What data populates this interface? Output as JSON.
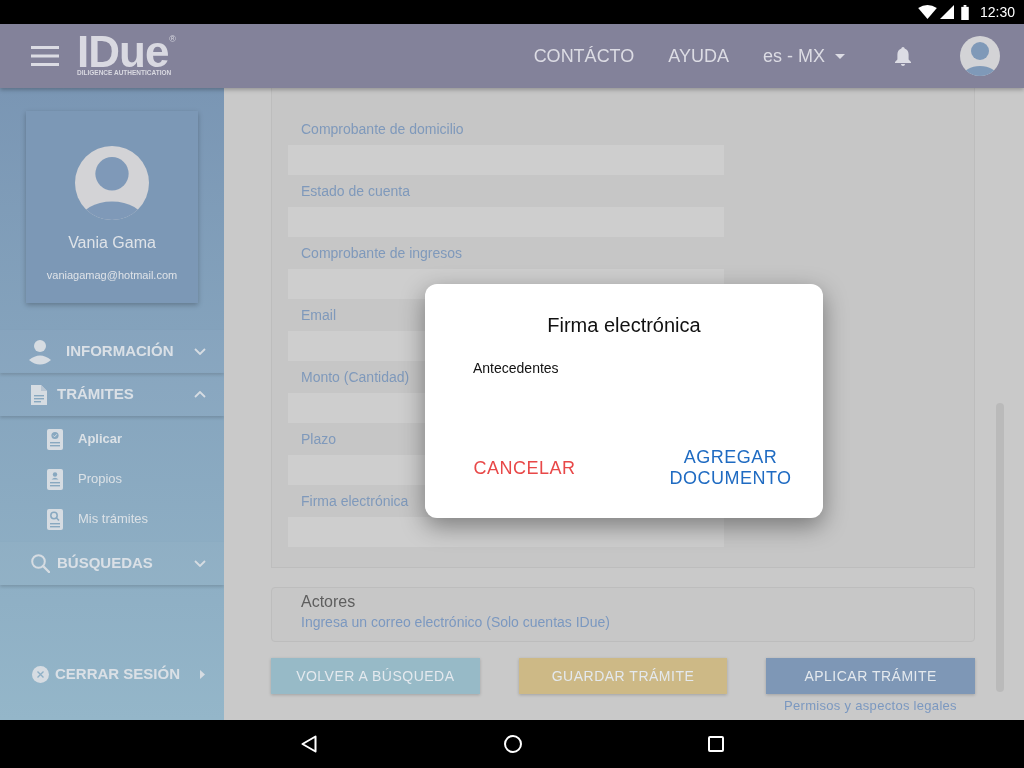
{
  "status_bar": {
    "time": "12:30"
  },
  "app_bar": {
    "logo": {
      "wordmark": "IDue",
      "mark": "®",
      "tagline": "DILIGENCE AUTHENTICATION"
    },
    "links": [
      "CONTÁCTO",
      "AYUDA"
    ],
    "language": "es - MX"
  },
  "sidebar": {
    "profile": {
      "name": "Vania Gama",
      "email": "vaniagamag@hotmail.com"
    },
    "menu": [
      {
        "label": "INFORMACIÓN",
        "expanded": false
      },
      {
        "label": "TRÁMITES",
        "expanded": true,
        "children": [
          {
            "label": "Aplicar",
            "selected": true
          },
          {
            "label": "Propios",
            "selected": false
          },
          {
            "label": "Mis trámites",
            "selected": false
          }
        ]
      },
      {
        "label": "BÚSQUEDAS",
        "expanded": false
      }
    ],
    "logout": "CERRAR SESIÓN"
  },
  "form": {
    "fields": [
      {
        "label": "Comprobante de domicilio"
      },
      {
        "label": "Estado de cuenta"
      },
      {
        "label": "Comprobante de ingresos"
      },
      {
        "label": "Email"
      },
      {
        "label": "Monto (Cantidad)"
      },
      {
        "label": "Plazo"
      },
      {
        "label": "Firma electrónica"
      }
    ],
    "actors": {
      "label": "Actores",
      "placeholder": "Ingresa un correo electrónico (Solo cuentas IDue)"
    },
    "buttons": [
      {
        "label": "VOLVER A BÚSQUEDA",
        "color": "#97bac7"
      },
      {
        "label": "GUARDAR TRÁMITE",
        "color": "#cdb986"
      },
      {
        "label": "APLICAR TRÁMITE",
        "color": "#7e97b6"
      }
    ],
    "legal_link": "Permisos y aspectos legales"
  },
  "dialog": {
    "title": "Firma electrónica",
    "body": "Antecedentes",
    "actions": [
      {
        "label": "CANCELAR",
        "color": "#e84848"
      },
      {
        "label": "AGREGAR DOCUMENTO",
        "color": "#1f6bc2"
      }
    ]
  }
}
